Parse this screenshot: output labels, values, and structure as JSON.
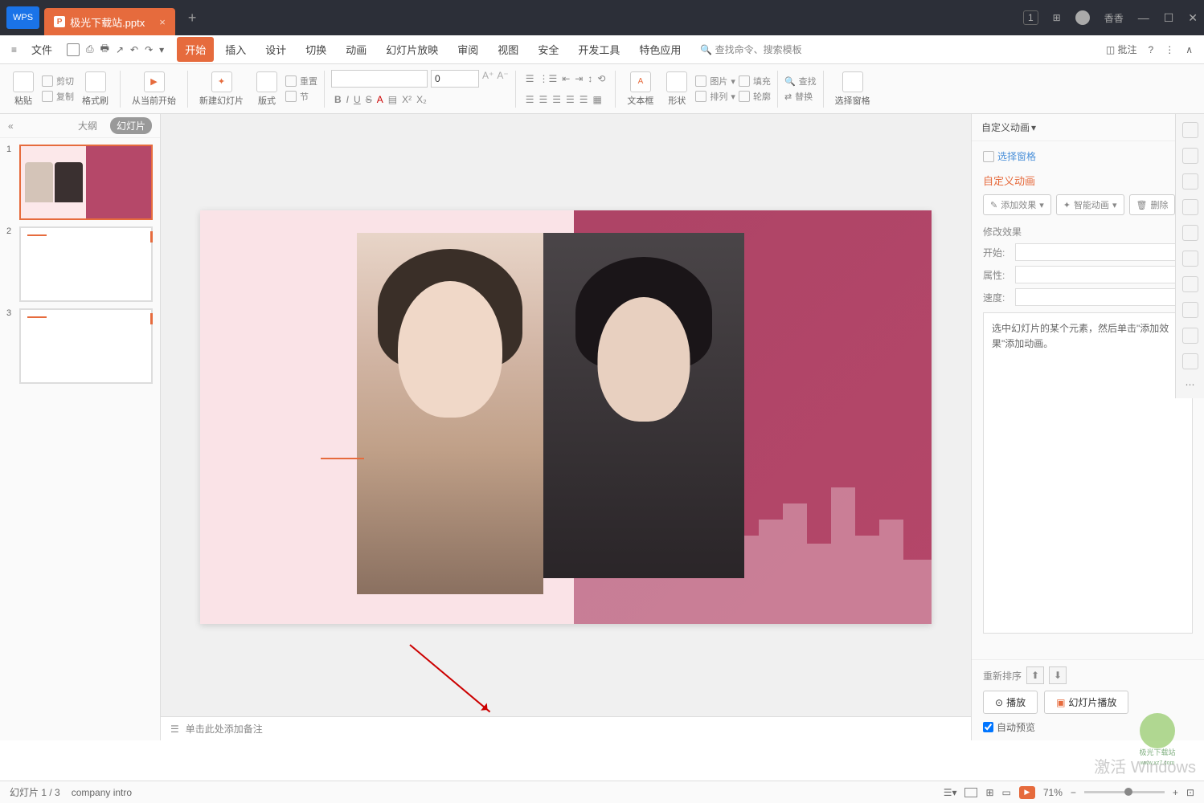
{
  "titlebar": {
    "logo": "WPS",
    "tab_filename": "极光下载站.pptx",
    "user": "香香",
    "badge": "1"
  },
  "menubar": {
    "file": "文件",
    "items": [
      "开始",
      "插入",
      "设计",
      "切换",
      "动画",
      "幻灯片放映",
      "审阅",
      "视图",
      "安全",
      "开发工具",
      "特色应用"
    ],
    "active_index": 0,
    "search_placeholder": "查找命令、搜索模板",
    "comment": "批注"
  },
  "ribbon": {
    "paste": "粘贴",
    "cut": "剪切",
    "copy": "复制",
    "format_painter": "格式刷",
    "play_from_current": "从当前开始",
    "new_slide": "新建幻灯片",
    "layout": "版式",
    "section": "节",
    "reset": "重置",
    "font_size": "0",
    "textbox": "文本框",
    "shapes": "形状",
    "picture": "图片",
    "arrange": "排列",
    "fill": "填充",
    "outline": "轮廓",
    "find": "查找",
    "replace": "替换",
    "select_pane": "选择窗格"
  },
  "left_panel": {
    "outline_tab": "大纲",
    "slides_tab": "幻灯片",
    "slides": [
      {
        "num": "1",
        "selected": true
      },
      {
        "num": "2",
        "selected": false
      },
      {
        "num": "3",
        "selected": false
      }
    ]
  },
  "notes": {
    "placeholder": "单击此处添加备注"
  },
  "right_panel": {
    "title": "自定义动画",
    "select_pane": "选择窗格",
    "section_title": "自定义动画",
    "add_effect": "添加效果",
    "smart_anim": "智能动画",
    "delete": "删除",
    "modify_label": "修改效果",
    "start_label": "开始:",
    "property_label": "属性:",
    "speed_label": "速度:",
    "hint_text": "选中幻灯片的某个元素，然后单击\"添加效果\"添加动画。",
    "reorder": "重新排序",
    "play": "播放",
    "slideshow_play": "幻灯片播放",
    "auto_preview": "自动预览"
  },
  "statusbar": {
    "slide_indicator": "幻灯片 1 / 3",
    "template": "company intro",
    "zoom": "71%"
  },
  "watermarks": {
    "activate": "激活 Windows",
    "site": "极光下载站",
    "url": "www.xz7.com"
  }
}
